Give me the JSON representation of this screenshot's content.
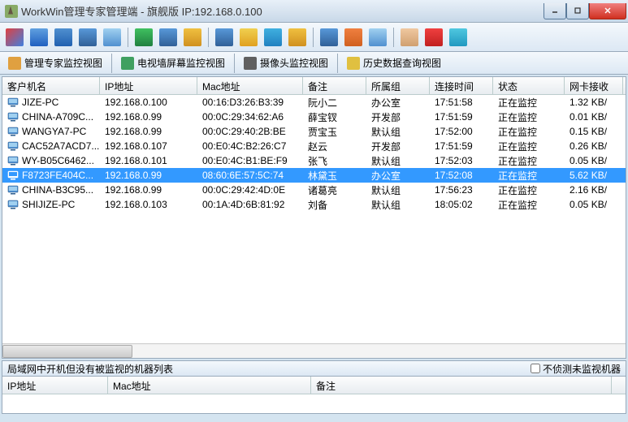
{
  "window": {
    "title": "WorkWin管理专家管理端 - 旗舰版 IP:192.168.0.100"
  },
  "toolbar_icons": [
    {
      "name": "icon-a",
      "bg": "linear-gradient(135deg,#e04040,#4080e0)"
    },
    {
      "name": "icon-b",
      "bg": "linear-gradient(#60a0e0,#2060c0)"
    },
    {
      "name": "icon-c",
      "bg": "linear-gradient(#5090d0,#2060b0)"
    },
    {
      "name": "icon-d",
      "bg": "linear-gradient(#5898d8,#306098)"
    },
    {
      "name": "icon-e",
      "bg": "linear-gradient(#a0d0f0,#5090d0)"
    },
    {
      "name": "icon-f",
      "bg": "linear-gradient(#40c060,#208040)"
    },
    {
      "name": "icon-g",
      "bg": "linear-gradient(#5898d8,#306098)"
    },
    {
      "name": "icon-h",
      "bg": "linear-gradient(#f0c040,#d09020)"
    },
    {
      "name": "icon-i",
      "bg": "linear-gradient(#5898d8,#306098)"
    },
    {
      "name": "icon-j",
      "bg": "linear-gradient(#f0d050,#e0a020)"
    },
    {
      "name": "icon-k",
      "bg": "linear-gradient(#40b0e0,#2080c0)"
    },
    {
      "name": "icon-l",
      "bg": "linear-gradient(#f0c040,#d09020)"
    },
    {
      "name": "icon-m",
      "bg": "linear-gradient(#5898d8,#306098)"
    },
    {
      "name": "icon-n",
      "bg": "linear-gradient(#f08040,#d06020)"
    },
    {
      "name": "icon-o",
      "bg": "linear-gradient(#a0d0f0,#5090d0)"
    },
    {
      "name": "icon-p",
      "bg": "linear-gradient(#f0c8a0,#d0a070)"
    },
    {
      "name": "icon-q",
      "bg": "linear-gradient(#f04040,#c02020)"
    },
    {
      "name": "icon-r",
      "bg": "linear-gradient(#50c8e0,#2098c0)"
    }
  ],
  "viewtabs": [
    {
      "icon": "#e0a040",
      "label": "管理专家监控视图"
    },
    {
      "icon": "#40a060",
      "label": "电视墙屏幕监控视图"
    },
    {
      "icon": "#606060",
      "label": "摄像头监控视图"
    },
    {
      "icon": "#e0c040",
      "label": "历史数据查询视图"
    }
  ],
  "columns": [
    "客户机名",
    "IP地址",
    "Mac地址",
    "备注",
    "所属组",
    "连接时间",
    "状态",
    "网卡接收"
  ],
  "rows": [
    {
      "name": "JIZE-PC",
      "ip": "192.168.0.100",
      "mac": "00:16:D3:26:B3:39",
      "note": "阮小二",
      "group": "办公室",
      "time": "17:51:58",
      "status": "正在监控",
      "net": "1.32 KB/",
      "sel": false
    },
    {
      "name": "CHINA-A709C...",
      "ip": "192.168.0.99",
      "mac": "00:0C:29:34:62:A6",
      "note": "薛宝钗",
      "group": "开发部",
      "time": "17:51:59",
      "status": "正在监控",
      "net": "0.01 KB/",
      "sel": false
    },
    {
      "name": "WANGYA7-PC",
      "ip": "192.168.0.99",
      "mac": "00:0C:29:40:2B:BE",
      "note": "贾宝玉",
      "group": "默认组",
      "time": "17:52:00",
      "status": "正在监控",
      "net": "0.15 KB/",
      "sel": false
    },
    {
      "name": "CAC52A7ACD7...",
      "ip": "192.168.0.107",
      "mac": "00:E0:4C:B2:26:C7",
      "note": "赵云",
      "group": "开发部",
      "time": "17:51:59",
      "status": "正在监控",
      "net": "0.26 KB/",
      "sel": false
    },
    {
      "name": "WY-B05C6462...",
      "ip": "192.168.0.101",
      "mac": "00:E0:4C:B1:BE:F9",
      "note": "张飞",
      "group": "默认组",
      "time": "17:52:03",
      "status": "正在监控",
      "net": "0.05 KB/",
      "sel": false
    },
    {
      "name": "F8723FE404C...",
      "ip": "192.168.0.99",
      "mac": "08:60:6E:57:5C:74",
      "note": "林黛玉",
      "group": "办公室",
      "time": "17:52:08",
      "status": "正在监控",
      "net": "5.62 KB/",
      "sel": true
    },
    {
      "name": "CHINA-B3C95...",
      "ip": "192.168.0.99",
      "mac": "00:0C:29:42:4D:0E",
      "note": "诸葛亮",
      "group": "默认组",
      "time": "17:56:23",
      "status": "正在监控",
      "net": "2.16 KB/",
      "sel": false
    },
    {
      "name": "SHIJIZE-PC",
      "ip": "192.168.0.103",
      "mac": "00:1A:4D:6B:81:92",
      "note": "刘备",
      "group": "默认组",
      "time": "18:05:02",
      "status": "正在监控",
      "net": "0.05 KB/",
      "sel": false
    }
  ],
  "bottom": {
    "title": "局域网中开机但没有被监视的机器列表",
    "checkbox_label": "不侦测未监视机器",
    "columns": [
      "IP地址",
      "Mac地址",
      "备注"
    ]
  }
}
